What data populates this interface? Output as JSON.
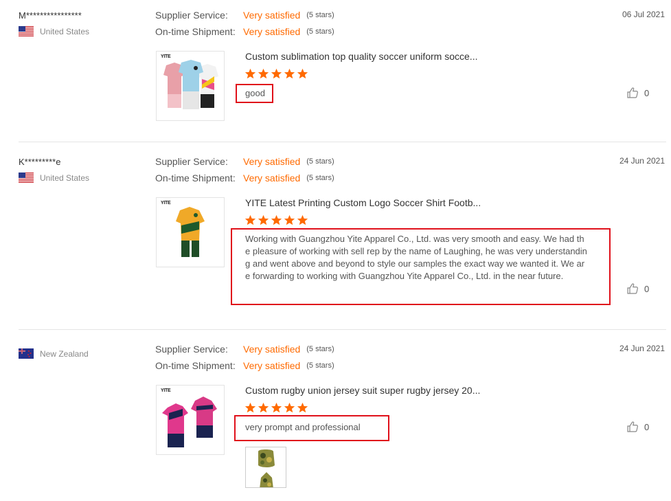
{
  "reviews": [
    {
      "buyer": "M****************",
      "country": "United States",
      "supplier_service": {
        "label": "Supplier Service:",
        "value": "Very satisfied",
        "stars_text": "(5 stars)"
      },
      "ontime_shipment": {
        "label": "On-time Shipment:",
        "value": "Very satisfied",
        "stars_text": "(5 stars)"
      },
      "date": "06 Jul 2021",
      "product_brand": "YITE",
      "product_title": "Custom sublimation top quality soccer uniform socce...",
      "rating": 5,
      "comment": "good",
      "likes": "0"
    },
    {
      "buyer": "K*********e",
      "country": "United States",
      "supplier_service": {
        "label": "Supplier Service:",
        "value": "Very satisfied",
        "stars_text": "(5 stars)"
      },
      "ontime_shipment": {
        "label": "On-time Shipment:",
        "value": "Very satisfied",
        "stars_text": "(5 stars)"
      },
      "date": "24 Jun 2021",
      "product_brand": "YITE",
      "product_title": "YITE Latest Printing Custom Logo Soccer Shirt Footb...",
      "rating": 5,
      "comment": "Working with Guangzhou Yite Apparel Co., Ltd. was very smooth and easy.  We had the pleasure of working with sell rep by the name of Laughing, he was very understanding and went above and beyond to style our samples the exact way we wanted it.  We are forwarding to working with Guangzhou Yite Apparel Co., Ltd. in the near future.",
      "likes": "0"
    },
    {
      "buyer": "",
      "country": "New Zealand",
      "supplier_service": {
        "label": "Supplier Service:",
        "value": "Very satisfied",
        "stars_text": "(5 stars)"
      },
      "ontime_shipment": {
        "label": "On-time Shipment:",
        "value": "Very satisfied",
        "stars_text": "(5 stars)"
      },
      "date": "24 Jun 2021",
      "product_brand": "YITE",
      "product_title": "Custom rugby union jersey suit super rugby jersey 20...",
      "rating": 5,
      "comment": "very prompt and professional",
      "likes": "0"
    }
  ],
  "colors": {
    "accent": "#ff6a00",
    "highlight_box": "#e0101a",
    "separator": "#e5e5e5"
  },
  "icons": {
    "like": "thumbs-up-icon",
    "star": "star-icon"
  }
}
